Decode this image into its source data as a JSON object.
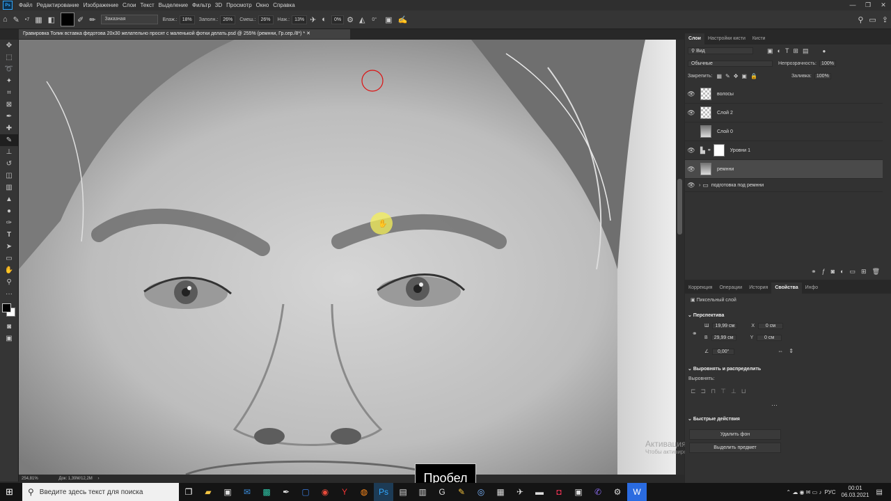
{
  "app": {
    "name": "Ps"
  },
  "menu": [
    "Файл",
    "Редактирование",
    "Изображение",
    "Слои",
    "Текст",
    "Выделение",
    "Фильтр",
    "3D",
    "Просмотр",
    "Окно",
    "Справка"
  ],
  "options": {
    "brush_size": "7",
    "mode": "Заказная",
    "flow_label": "Влаж.:",
    "flow": "18%",
    "fill_label": "Заполн.:",
    "fill": "26%",
    "mix_label": "Смеш.:",
    "mix": "26%",
    "press_label": "Наж.:",
    "press": "13%",
    "opacity": "0%",
    "angle": "0°"
  },
  "document": {
    "title": "Гравировка Толик вставка федотова 20x30 желательно просят с маленькой фотки делать.psd @ 255% (ремнни, Гр.сер./8*) *",
    "zoom": "254,81%",
    "doc_size": "Док: 1,39М/12,2М"
  },
  "layers_panel": {
    "tabs": [
      "Слои",
      "Настройки кисти",
      "Кисти"
    ],
    "filter": "Вид",
    "blend_mode": "Обычные",
    "opacity_label": "Непрозрачность:",
    "opacity": "100%",
    "lock_label": "Закрепить:",
    "fill_label": "Заливка:",
    "fill": "100%",
    "layers": [
      {
        "name": "волосы",
        "visible": true,
        "thumb": "transparent"
      },
      {
        "name": "Слой 2",
        "visible": true,
        "thumb": "transparent"
      },
      {
        "name": "Слой 0",
        "visible": false,
        "thumb": "photo"
      },
      {
        "name": "Уровни 1",
        "visible": true,
        "thumb": "adjustment"
      },
      {
        "name": "ремнни",
        "visible": true,
        "thumb": "photo",
        "selected": true
      },
      {
        "name": "подготовка под ремнни",
        "visible": true,
        "thumb": "group"
      }
    ]
  },
  "properties_panel": {
    "tabs": [
      "Коррекция",
      "Операции",
      "История",
      "Свойства",
      "Инфо"
    ],
    "type": "Пиксельный слой",
    "section_transform": "Перспектива",
    "w_label": "Ш",
    "w": "19,99 см",
    "h_label": "В",
    "h": "29,99 см",
    "x_label": "X",
    "x": "0 см",
    "y_label": "Y",
    "y": "0 см",
    "angle": "0,00°",
    "section_align": "Выровнять и распределить",
    "align_label": "Выровнять:",
    "section_quick": "Быстрые действия",
    "btn_remove_bg": "Удалить фон",
    "btn_select_subject": "Выделить предмет"
  },
  "watermark": {
    "line1": "Активация Windows",
    "line2": "Чтобы активировать Windows, перейдите в раздел \"Параметры\"."
  },
  "key_hint": "Пробел",
  "taskbar": {
    "search_placeholder": "Введите здесь текст для поиска",
    "lang": "РУС",
    "time": "00:01",
    "date": "06.03.2021"
  }
}
